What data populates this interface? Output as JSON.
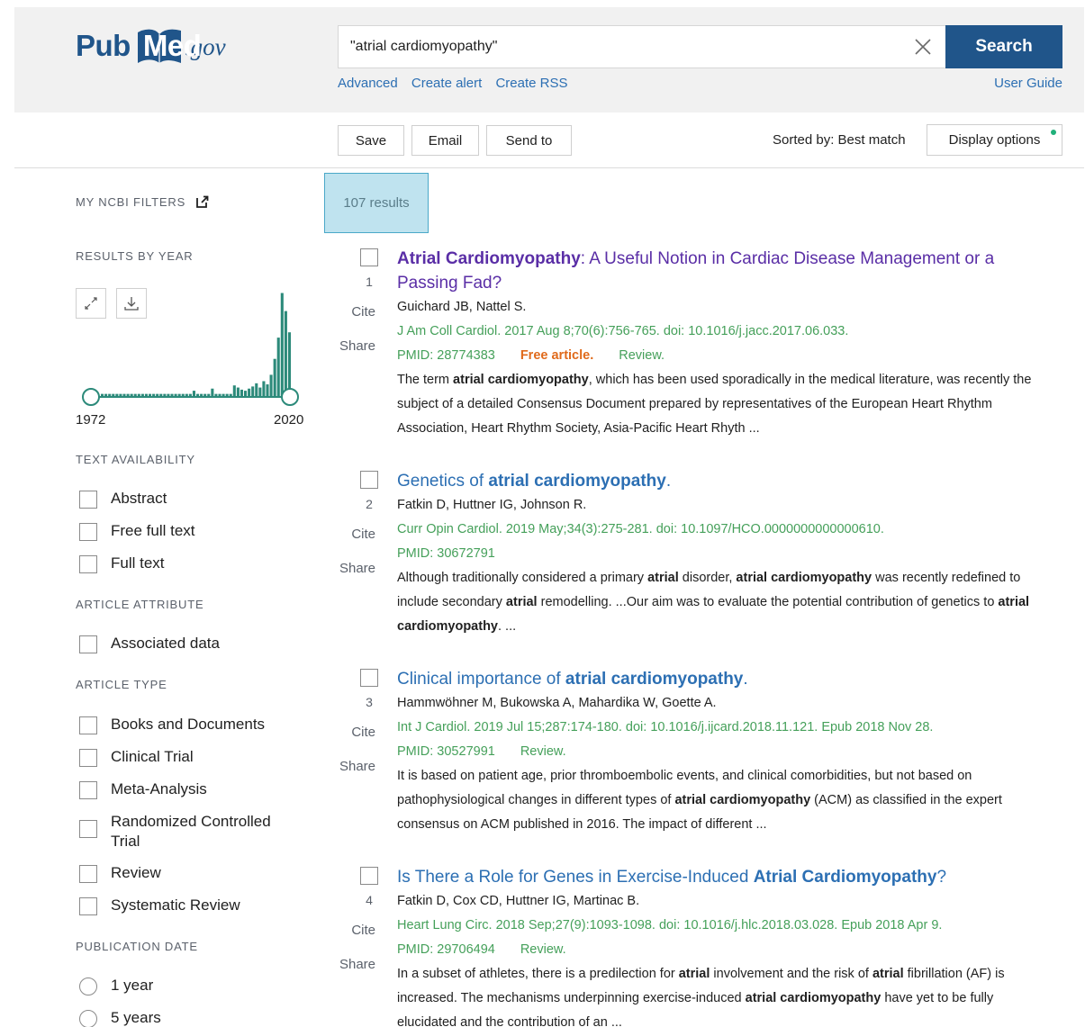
{
  "header": {
    "logo_pub": "Pub",
    "logo_med": "Med",
    "logo_gov": ".gov",
    "search_value": "\"atrial cardiomyopathy\"",
    "search_button": "Search",
    "links": [
      "Advanced",
      "Create alert",
      "Create RSS"
    ],
    "user_guide": "User Guide"
  },
  "toolbar": {
    "save": "Save",
    "email": "Email",
    "send_to": "Send to",
    "sorted_by": "Sorted by: Best match",
    "display_options": "Display options"
  },
  "results_count": "107 results",
  "sidebar": {
    "my_ncbi_filters": "MY NCBI FILTERS",
    "results_by_year": "RESULTS BY YEAR",
    "year_start": "1972",
    "year_end": "2020",
    "text_availability": "TEXT AVAILABILITY",
    "text_filters": [
      "Abstract",
      "Free full text",
      "Full text"
    ],
    "article_attribute": "ARTICLE ATTRIBUTE",
    "attribute_filters": [
      "Associated data"
    ],
    "article_type": "ARTICLE TYPE",
    "type_filters": [
      "Books and Documents",
      "Clinical Trial",
      "Meta-Analysis",
      "Randomized Controlled Trial",
      "Review",
      "Systematic Review"
    ],
    "publication_date": "PUBLICATION DATE",
    "date_options": [
      "1 year",
      "5 years"
    ]
  },
  "chart_data": {
    "type": "bar",
    "x_range": [
      1972,
      2020
    ],
    "bar_heights_relative": [
      0.02,
      0.02,
      0.02,
      0.02,
      0.02,
      0.02,
      0.02,
      0.02,
      0.02,
      0.02,
      0.02,
      0.02,
      0.02,
      0.02,
      0.02,
      0.02,
      0.02,
      0.02,
      0.02,
      0.02,
      0.02,
      0.02,
      0.02,
      0.02,
      0.02,
      0.05,
      0.02,
      0.02,
      0.02,
      0.02,
      0.07,
      0.02,
      0.02,
      0.02,
      0.02,
      0.02,
      0.1,
      0.08,
      0.06,
      0.05,
      0.07,
      0.09,
      0.12,
      0.08,
      0.14,
      0.11,
      0.2,
      0.35,
      0.55,
      0.97,
      0.8,
      0.6
    ]
  },
  "actions": {
    "cite": "Cite",
    "share": "Share"
  },
  "results": [
    {
      "num": "1",
      "title_parts": [
        {
          "t": "Atrial Cardiomyopathy",
          "h": true
        },
        {
          "t": ": A Useful Notion in Cardiac Disease Management or a Passing Fad?",
          "h": false
        }
      ],
      "authors": "Guichard JB, Nattel S.",
      "journal": "J Am Coll Cardiol. 2017 Aug 8;70(6):756-765. doi: 10.1016/j.jacc.2017.06.033.",
      "pmid": "PMID: 28774383",
      "free": "Free article.",
      "review": "Review.",
      "snippet_parts": [
        {
          "t": "The term ",
          "b": false
        },
        {
          "t": "atrial cardiomyopathy",
          "b": true
        },
        {
          "t": ", which has been used sporadically in the medical literature, was recently the subject of a detailed Consensus Document prepared by representatives of the European Heart Rhythm Association, Heart Rhythm Society, Asia-Pacific Heart Rhyth ...",
          "b": false
        }
      ]
    },
    {
      "num": "2",
      "title_parts": [
        {
          "t": "Genetics of ",
          "h": false
        },
        {
          "t": "atrial cardiomyopathy",
          "h": true
        },
        {
          "t": ".",
          "h": false
        }
      ],
      "authors": "Fatkin D, Huttner IG, Johnson R.",
      "journal": "Curr Opin Cardiol. 2019 May;34(3):275-281. doi: 10.1097/HCO.0000000000000610.",
      "pmid": "PMID: 30672791",
      "free": "",
      "review": "",
      "snippet_parts": [
        {
          "t": "Although traditionally considered a primary ",
          "b": false
        },
        {
          "t": "atrial",
          "b": true
        },
        {
          "t": " disorder, ",
          "b": false
        },
        {
          "t": "atrial cardiomyopathy",
          "b": true
        },
        {
          "t": " was recently redefined to include secondary ",
          "b": false
        },
        {
          "t": "atrial",
          "b": true
        },
        {
          "t": " remodelling. ...Our aim was to evaluate the potential contribution of genetics to ",
          "b": false
        },
        {
          "t": "atrial cardiomyopathy",
          "b": true
        },
        {
          "t": ". ...",
          "b": false
        }
      ]
    },
    {
      "num": "3",
      "title_parts": [
        {
          "t": "Clinical importance of ",
          "h": false
        },
        {
          "t": "atrial cardiomyopathy",
          "h": true
        },
        {
          "t": ".",
          "h": false
        }
      ],
      "authors": "Hammwöhner M, Bukowska A, Mahardika W, Goette A.",
      "journal": "Int J Cardiol. 2019 Jul 15;287:174-180. doi: 10.1016/j.ijcard.2018.11.121. Epub 2018 Nov 28.",
      "pmid": "PMID: 30527991",
      "free": "",
      "review": "Review.",
      "snippet_parts": [
        {
          "t": "It is based on patient age, prior thromboembolic events, and clinical comorbidities, but not based on pathophysiological changes in different types of ",
          "b": false
        },
        {
          "t": "atrial cardiomyopathy",
          "b": true
        },
        {
          "t": " (ACM) as classified in the expert consensus on ACM published in 2016. The impact of different ...",
          "b": false
        }
      ]
    },
    {
      "num": "4",
      "title_parts": [
        {
          "t": "Is There a Role for Genes in Exercise-Induced ",
          "h": false
        },
        {
          "t": "Atrial Cardiomyopathy",
          "h": true
        },
        {
          "t": "?",
          "h": false
        }
      ],
      "authors": "Fatkin D, Cox CD, Huttner IG, Martinac B.",
      "journal": "Heart Lung Circ. 2018 Sep;27(9):1093-1098. doi: 10.1016/j.hlc.2018.03.028. Epub 2018 Apr 9.",
      "pmid": "PMID: 29706494",
      "free": "",
      "review": "Review.",
      "snippet_parts": [
        {
          "t": "In a subset of athletes, there is a predilection for ",
          "b": false
        },
        {
          "t": "atrial",
          "b": true
        },
        {
          "t": " involvement and the risk of ",
          "b": false
        },
        {
          "t": "atrial",
          "b": true
        },
        {
          "t": " fibrillation (AF) is increased. The mechanisms underpinning exercise-induced ",
          "b": false
        },
        {
          "t": "atrial cardiomyopathy",
          "b": true
        },
        {
          "t": " have yet to be fully elucidated and the contribution of an ...",
          "b": false
        }
      ]
    }
  ]
}
